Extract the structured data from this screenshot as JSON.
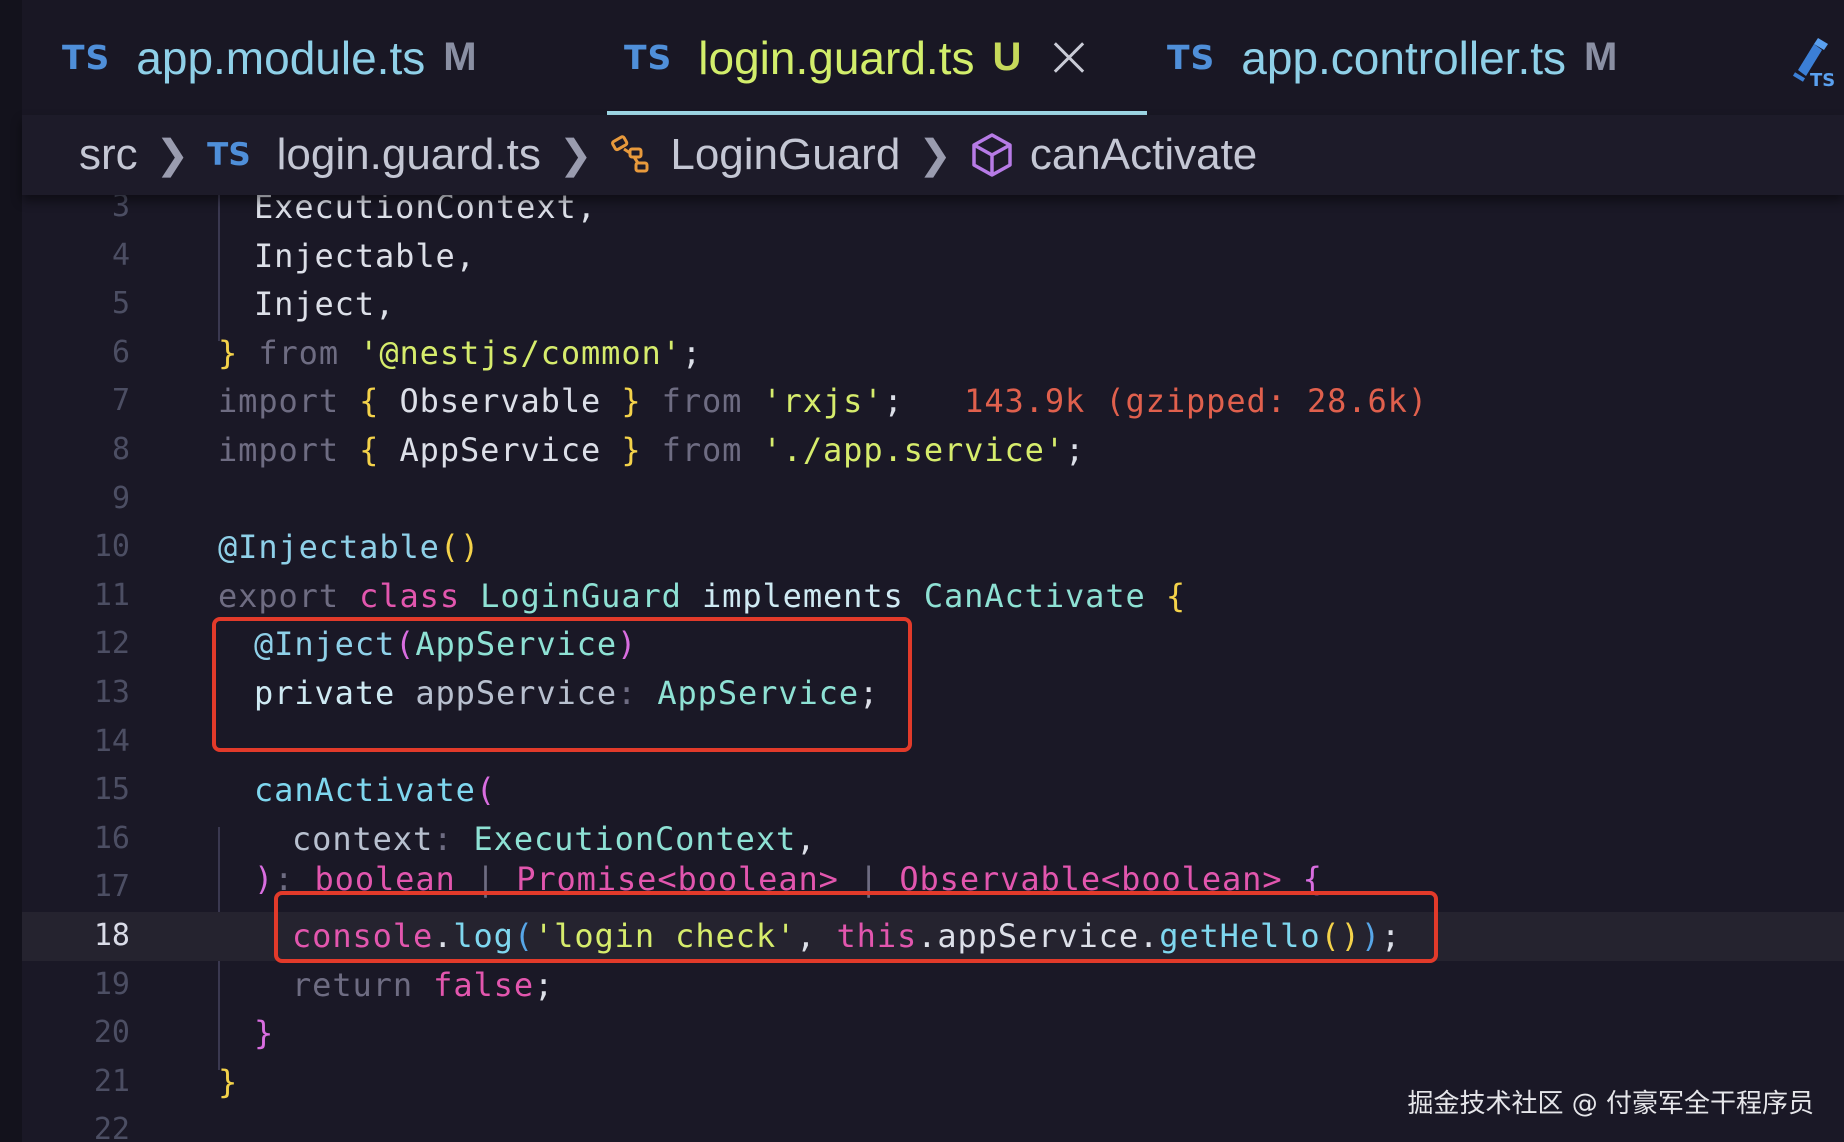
{
  "tabs": [
    {
      "icon": "TS",
      "name": "app.module.ts",
      "status": "M",
      "active": false
    },
    {
      "icon": "TS",
      "name": "login.guard.ts",
      "status": "U",
      "active": true
    },
    {
      "icon": "TS",
      "name": "app.controller.ts",
      "status": "M",
      "active": false
    }
  ],
  "toolbar": {
    "icon": "typescript-debug-icon"
  },
  "breadcrumb": {
    "folder": "src",
    "file_icon": "TS",
    "file": "login.guard.ts",
    "class_icon": "class-icon",
    "class_name": "LoginGuard",
    "method_icon": "method-cube-icon",
    "method": "canActivate"
  },
  "editor": {
    "current_line": 18,
    "line_numbers": [
      "3",
      "4",
      "5",
      "6",
      "7",
      "8",
      "9",
      "10",
      "11",
      "12",
      "13",
      "14",
      "15",
      "16",
      "17",
      "18",
      "19",
      "20",
      "21",
      "22"
    ],
    "lines": {
      "l3": [
        "ExecutionContext,"
      ],
      "l4": [
        "Injectable,"
      ],
      "l5": [
        "Inject,"
      ],
      "l6": [
        "}",
        " from ",
        "'@nestjs/common'",
        ";"
      ],
      "l7": [
        "import ",
        "{",
        " Observable ",
        "}",
        " from ",
        "'rxjs'",
        ";",
        "   143.9k (gzipped: 28.6k)"
      ],
      "l8": [
        "import ",
        "{",
        " AppService ",
        "}",
        " from ",
        "'./app.service'",
        ";"
      ],
      "l10": [
        "@Injectable",
        "()"
      ],
      "l11": [
        "export ",
        "class ",
        "LoginGuard ",
        "implements ",
        "CanActivate ",
        "{"
      ],
      "l12": [
        "@Inject",
        "(",
        "AppService",
        ")"
      ],
      "l13": [
        "private ",
        "appService",
        ": ",
        "AppService",
        ";"
      ],
      "l15": [
        "canActivate",
        "("
      ],
      "l16": [
        "context",
        ": ",
        "ExecutionContext",
        ","
      ],
      "l17": [
        ")",
        ": ",
        "boolean",
        " | ",
        "Promise<boolean>",
        " | ",
        "Observable<boolean>",
        " {"
      ],
      "l18": [
        "console",
        ".",
        "log",
        "(",
        "'login check'",
        ", ",
        "this",
        ".",
        "appService",
        ".",
        "getHello",
        "()",
        ")",
        ";"
      ],
      "l19": [
        "return ",
        "false",
        ";"
      ],
      "l20": [
        "}"
      ],
      "l21": [
        "}"
      ]
    }
  },
  "watermark": "掘金技术社区 @ 付豪军全干程序员",
  "colors": {
    "background": "#1a1826",
    "highlight_box": "#e23a2a",
    "ts_icon": "#4f8fd9",
    "active_tab_text": "#d2ee6b"
  }
}
